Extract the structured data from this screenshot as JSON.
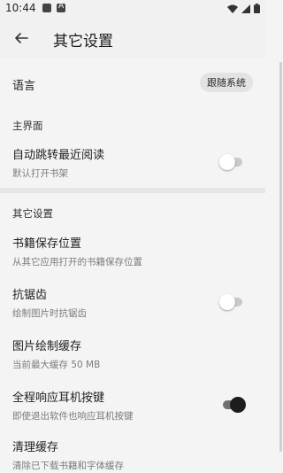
{
  "status_bar": {
    "time": "10:44",
    "left_icons": [
      "notification-square-icon",
      "app-a-icon"
    ],
    "right_icons": [
      "wifi-icon",
      "signal-icon",
      "battery-icon"
    ]
  },
  "app_bar": {
    "title": "其它设置",
    "back_icon": "arrow-back-icon"
  },
  "settings": {
    "language": {
      "label": "语言",
      "value": "跟随系统"
    },
    "main_section_title": "主界面",
    "auto_jump": {
      "label": "自动跳转最近阅读",
      "sub": "默认打开书架",
      "enabled": false
    },
    "other_section_title": "其它设置",
    "book_save": {
      "label": "书籍保存位置",
      "sub": "从其它应用打开的书籍保存位置"
    },
    "antialias": {
      "label": "抗锯齿",
      "sub": "绘制图片时抗锯齿",
      "enabled": false
    },
    "image_cache": {
      "label": "图片绘制缓存",
      "sub": "当前最大缓存 50 MB"
    },
    "earphone_keys": {
      "label": "全程响应耳机按键",
      "sub": "即使退出软件也响应耳机按键",
      "enabled": true
    },
    "clear_cache": {
      "label": "清理缓存",
      "sub": "清除已下载书籍和字体缓存"
    }
  },
  "colors": {
    "background": "#f4f4f4",
    "divider": "#e6e6e6",
    "toggle_on_thumb": "#1d1d1d",
    "toggle_off_track": "#c9c9c9"
  }
}
